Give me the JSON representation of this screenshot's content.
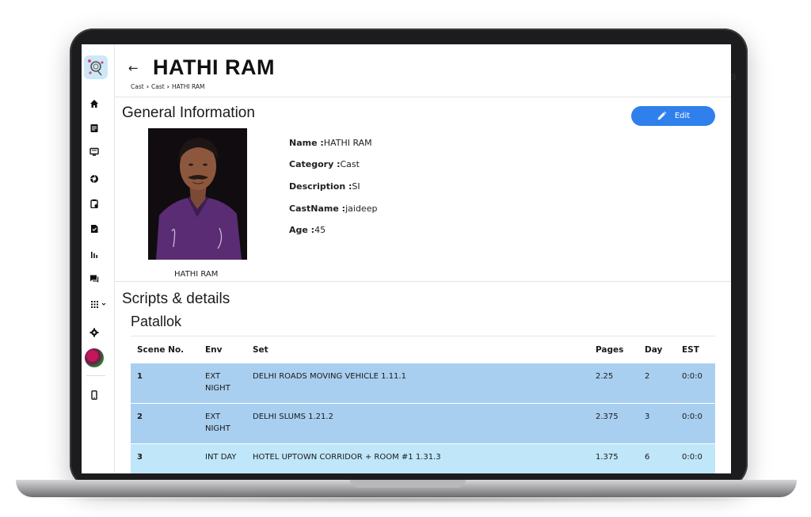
{
  "header": {
    "title": "HATHI RAM",
    "breadcrumb": [
      "Cast",
      "Cast",
      "HATHI RAM"
    ]
  },
  "edge_text": "3",
  "general": {
    "section_title": "General Information",
    "edit_label": "Edit",
    "photo_caption": "HATHI RAM",
    "fields": [
      {
        "key": "Name :",
        "value": "HATHI RAM"
      },
      {
        "key": "Category :",
        "value": "Cast"
      },
      {
        "key": "Description :",
        "value": "SI"
      },
      {
        "key": "CastName :",
        "value": "jaideep"
      },
      {
        "key": "Age :",
        "value": "45"
      }
    ]
  },
  "scripts": {
    "section_title": "Scripts & details",
    "script_name": "Patallok",
    "columns": [
      "Scene No.",
      "Env",
      "Set",
      "Pages",
      "Day",
      "EST"
    ],
    "rows": [
      {
        "scene": "1",
        "env": "EXT NIGHT",
        "set": "DELHI ROADS MOVING VEHICLE 1.11.1",
        "pages": "2.25",
        "day": "2",
        "est": "0:0:0",
        "color": "#a9cff0"
      },
      {
        "scene": "2",
        "env": "EXT NIGHT",
        "set": "DELHI SLUMS 1.21.2",
        "pages": "2.375",
        "day": "3",
        "est": "0:0:0",
        "color": "#a9cff0"
      },
      {
        "scene": "3",
        "env": "INT DAY",
        "set": "HOTEL UPTOWN CORRIDOR + ROOM #1 1.31.3",
        "pages": "1.375",
        "day": "6",
        "est": "0:0:0",
        "color": "#bfe6f9"
      }
    ]
  },
  "sidebar": {
    "icons": [
      "home-icon",
      "document-icon",
      "monitor-icon",
      "camera-aperture-icon",
      "clipboard-icon",
      "file-check-icon",
      "bar-chart-icon",
      "chat-icon",
      "grid-icon",
      "gear-icon",
      "phone-icon"
    ]
  },
  "colors": {
    "accent": "#2f80ed",
    "row_blue": "#a9cff0",
    "row_light": "#bfe6f9"
  }
}
